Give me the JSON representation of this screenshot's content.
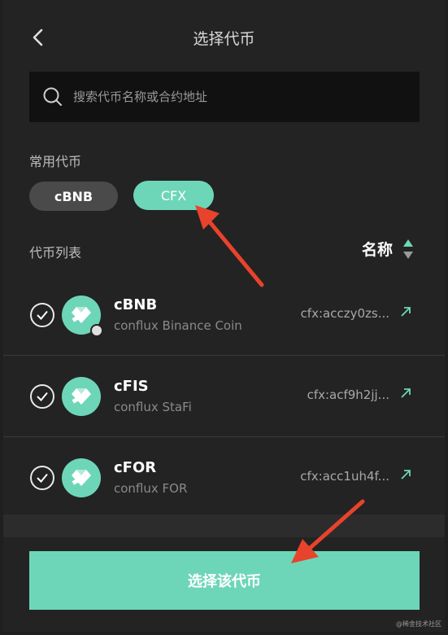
{
  "header": {
    "title": "选择代币"
  },
  "search": {
    "placeholder": "搜索代币名称或合约地址"
  },
  "common": {
    "label": "常用代币",
    "chips": [
      "cBNB",
      "CFX"
    ]
  },
  "list": {
    "label": "代币列表",
    "sort_label": "名称",
    "tokens": [
      {
        "symbol": "cBNB",
        "name": "conflux Binance Coin",
        "address": "cfx:acczy0zs..."
      },
      {
        "symbol": "cFIS",
        "name": "conflux StaFi",
        "address": "cfx:acf9h2jj..."
      },
      {
        "symbol": "cFOR",
        "name": "conflux FOR",
        "address": "cfx:acc1uh4f..."
      }
    ]
  },
  "footer": {
    "confirm_label": "选择该代币"
  },
  "watermark": "@稀金技术社区",
  "colors": {
    "accent": "#6ed6b8",
    "background": "#232323",
    "annotation_arrow": "#e8432c"
  }
}
